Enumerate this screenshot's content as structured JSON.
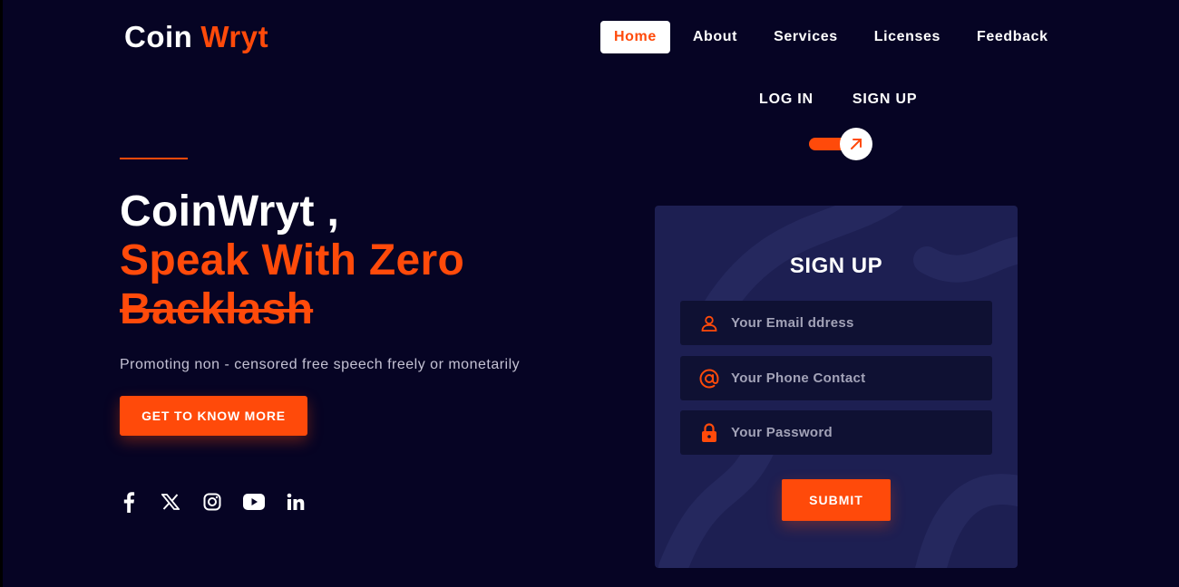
{
  "brand": {
    "name_part1": "Coin",
    "name_part2": "Wryt"
  },
  "nav": {
    "items": [
      {
        "label": "Home",
        "active": true
      },
      {
        "label": "About"
      },
      {
        "label": "Services"
      },
      {
        "label": "Licenses"
      },
      {
        "label": "Feedback"
      }
    ]
  },
  "auth": {
    "login_label": "LOG IN",
    "signup_label": "SIGN UP",
    "toggle_icon": "arrow-up-right-icon"
  },
  "hero": {
    "line1": "CoinWryt ,",
    "line2": "Speak With Zero",
    "line3": "Backlash",
    "subtitle": "Promoting non - censored free speech freely or monetarily",
    "cta_label": "GET TO KNOW MORE"
  },
  "socials": [
    {
      "icon": "facebook-icon"
    },
    {
      "icon": "x-twitter-icon"
    },
    {
      "icon": "instagram-icon"
    },
    {
      "icon": "youtube-icon"
    },
    {
      "icon": "linkedin-icon"
    }
  ],
  "signup_form": {
    "title": "SIGN UP",
    "email_placeholder": "Your Email ddress",
    "phone_placeholder": "Your Phone Contact",
    "password_placeholder": "Your Password",
    "submit_label": "SUBMIT"
  },
  "colors": {
    "background": "#060424",
    "accent": "#ff4a0a",
    "card": "#1d1f52",
    "field": "#0f1133"
  }
}
